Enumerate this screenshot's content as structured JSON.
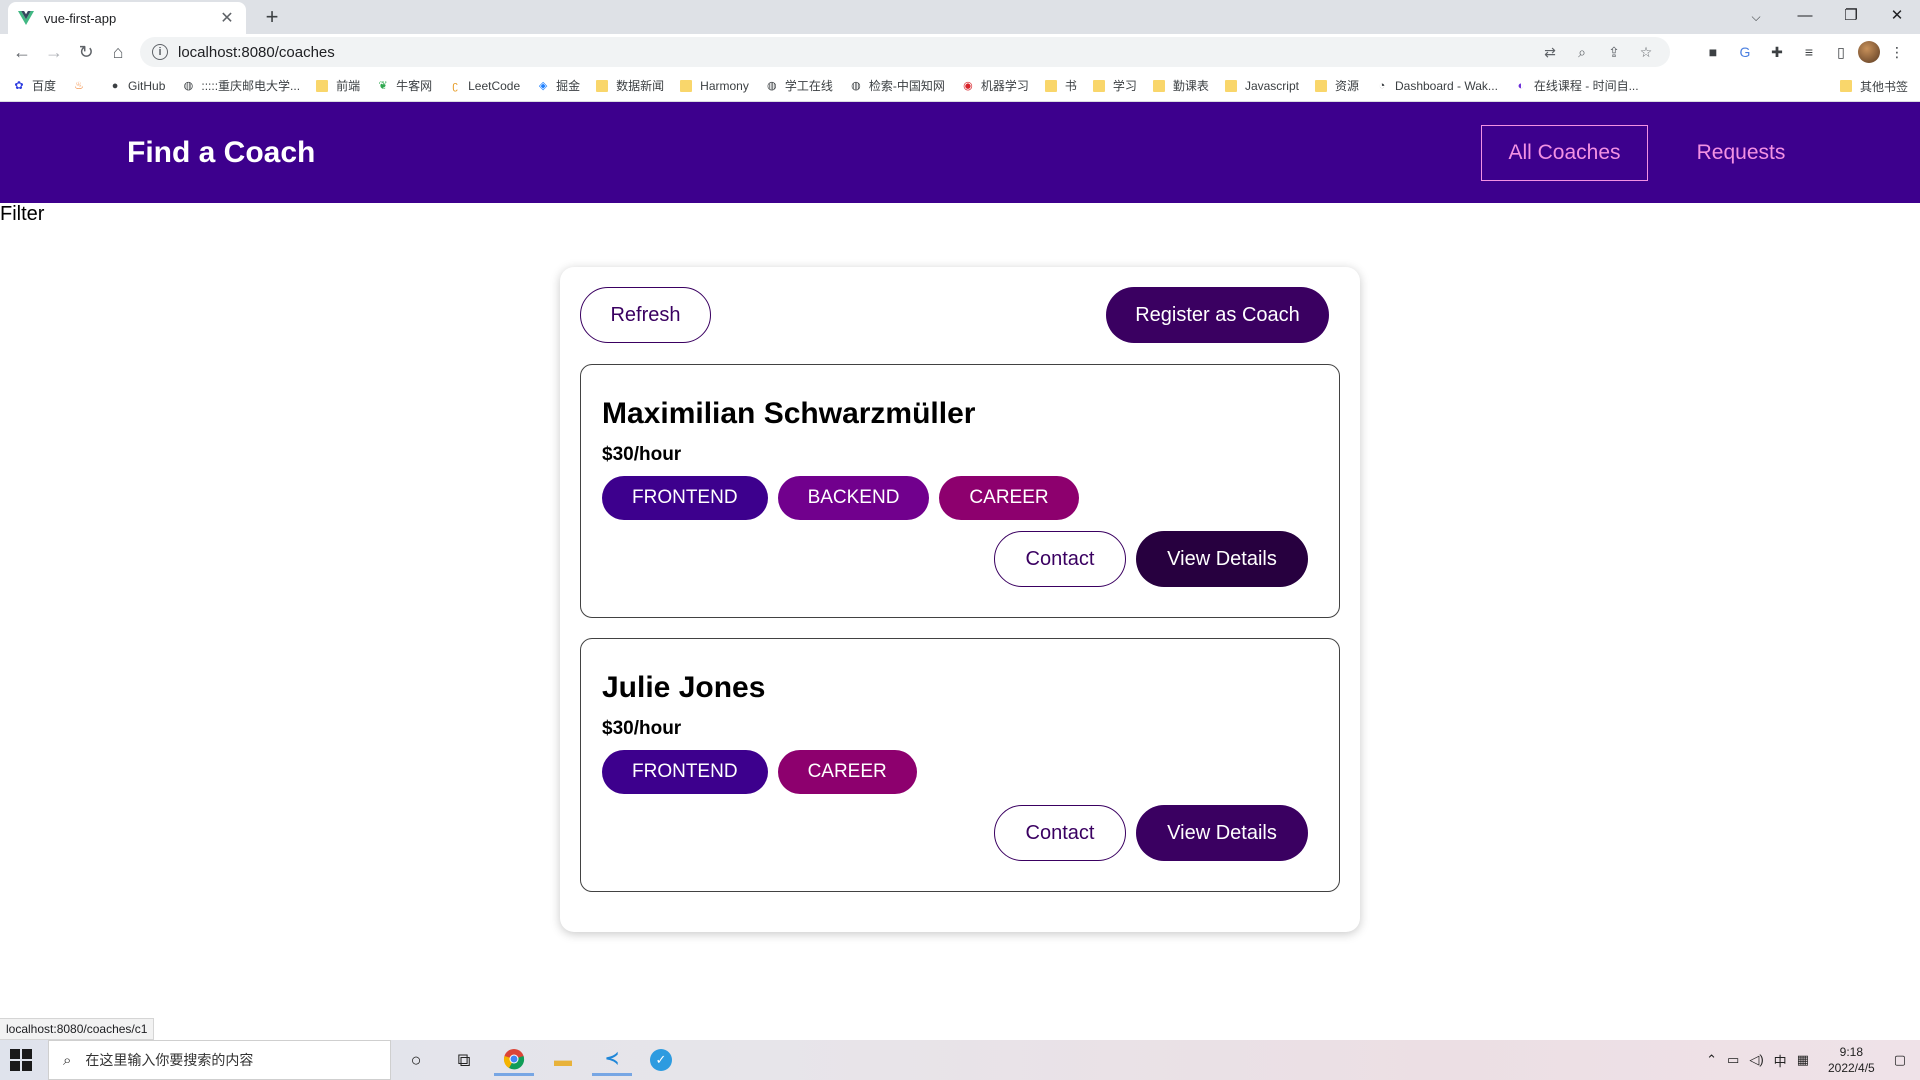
{
  "browser": {
    "tab_title": "vue-first-app",
    "tab_close": "✕",
    "new_tab": "+",
    "url": "localhost:8080/coaches",
    "bookmarks": [
      "百度",
      "GitHub",
      ":::::重庆邮电大学...",
      "前端",
      "牛客网",
      "LeetCode",
      "掘金",
      "数据新闻",
      "Harmony",
      "学工在线",
      "检索-中国知网",
      "机器学习",
      "书",
      "学习",
      "勤课表",
      "Javascript",
      "资源",
      "Dashboard - Wak...",
      "在线课程 - 时间自..."
    ],
    "other_bookmarks": "其他书签",
    "status_url": "localhost:8080/coaches/c1"
  },
  "header": {
    "title": "Find a Coach",
    "nav_all": "All Coaches",
    "nav_requests": "Requests"
  },
  "filter": {
    "label": "Filter"
  },
  "controls": {
    "refresh": "Refresh",
    "register": "Register as Coach"
  },
  "coaches": [
    {
      "name": "Maximilian Schwarzmüller",
      "rate": "$30/hour",
      "areas": [
        "FRONTEND",
        "BACKEND",
        "CAREER"
      ],
      "contact": "Contact",
      "details": "View Details"
    },
    {
      "name": "Julie Jones",
      "rate": "$30/hour",
      "areas": [
        "FRONTEND",
        "CAREER"
      ],
      "contact": "Contact",
      "details": "View Details"
    }
  ],
  "badge_colors": {
    "FRONTEND": "#3d008d",
    "BACKEND": "#71008d",
    "CAREER": "#8d006e"
  },
  "taskbar": {
    "search_placeholder": "在这里输入你要搜索的内容",
    "time": "9:18",
    "date": "2022/4/5",
    "ime": "中"
  }
}
